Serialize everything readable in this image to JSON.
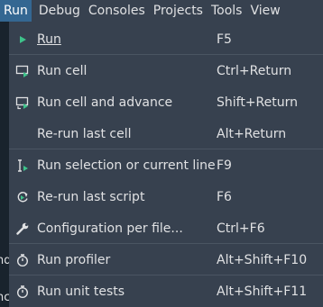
{
  "menubar": {
    "items": [
      {
        "label": "Run",
        "active": true
      },
      {
        "label": "Debug"
      },
      {
        "label": "Consoles"
      },
      {
        "label": "Projects"
      },
      {
        "label": "Tools"
      },
      {
        "label": "View"
      }
    ]
  },
  "background_fragments": [
    "nd",
    "nc"
  ],
  "run_menu": {
    "items": [
      {
        "label": "Run",
        "shortcut": "F5",
        "icon": "play-icon"
      },
      {
        "label": "Run cell",
        "shortcut": "Ctrl+Return",
        "icon": "run-cell-icon"
      },
      {
        "label": "Run cell and advance",
        "shortcut": "Shift+Return",
        "icon": "run-cell-advance-icon"
      },
      {
        "label": "Re-run last cell",
        "shortcut": "Alt+Return",
        "icon": ""
      },
      {
        "label": "Run selection or current line",
        "shortcut": "F9",
        "icon": "run-selection-icon"
      },
      {
        "label": "Re-run last script",
        "shortcut": "F6",
        "icon": "rerun-icon"
      },
      {
        "label": "Configuration per file...",
        "shortcut": "Ctrl+F6",
        "icon": "wrench-icon"
      },
      {
        "label": "Run profiler",
        "shortcut": "Alt+Shift+F10",
        "icon": "stopwatch-icon"
      },
      {
        "label": "Run unit tests",
        "shortcut": "Alt+Shift+F11",
        "icon": "stopwatch-icon"
      }
    ]
  },
  "colors": {
    "menubar_bg": "#37414f",
    "active_bg": "#346792",
    "text": "#e0e1e3",
    "accent_green": "#3ec38b",
    "background": "#19232d"
  }
}
